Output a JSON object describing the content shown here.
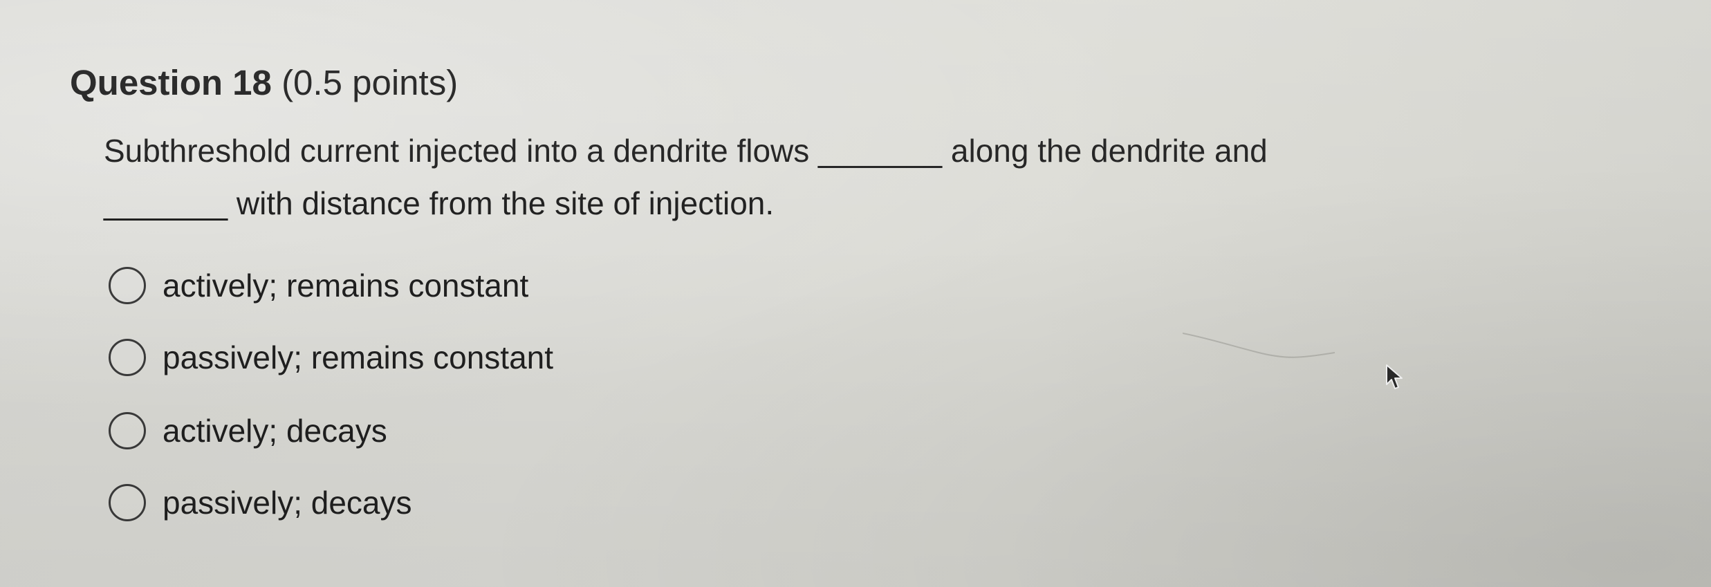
{
  "question": {
    "number_label": "Question 18",
    "points_label": "(0.5 points)",
    "prompt_line_1_start": "Subthreshold current injected into a dendrite flows ",
    "blank_1": "_______",
    "prompt_line_1_end": " along the dendrite and",
    "blank_2": "_______",
    "prompt_line_2_end": " with distance from the site of injection."
  },
  "options": [
    {
      "label": "actively; remains constant",
      "selected": false
    },
    {
      "label": "passively; remains constant",
      "selected": false
    },
    {
      "label": "actively; decays",
      "selected": false
    },
    {
      "label": "passively; decays",
      "selected": false
    }
  ],
  "icons": {
    "cursor": "mouse-pointer-arrow",
    "radio": "radio-button-unselected"
  },
  "colors": {
    "text": "#1f1f1f",
    "background": "#d8d8d3",
    "radio_border": "#3a3a3a"
  }
}
